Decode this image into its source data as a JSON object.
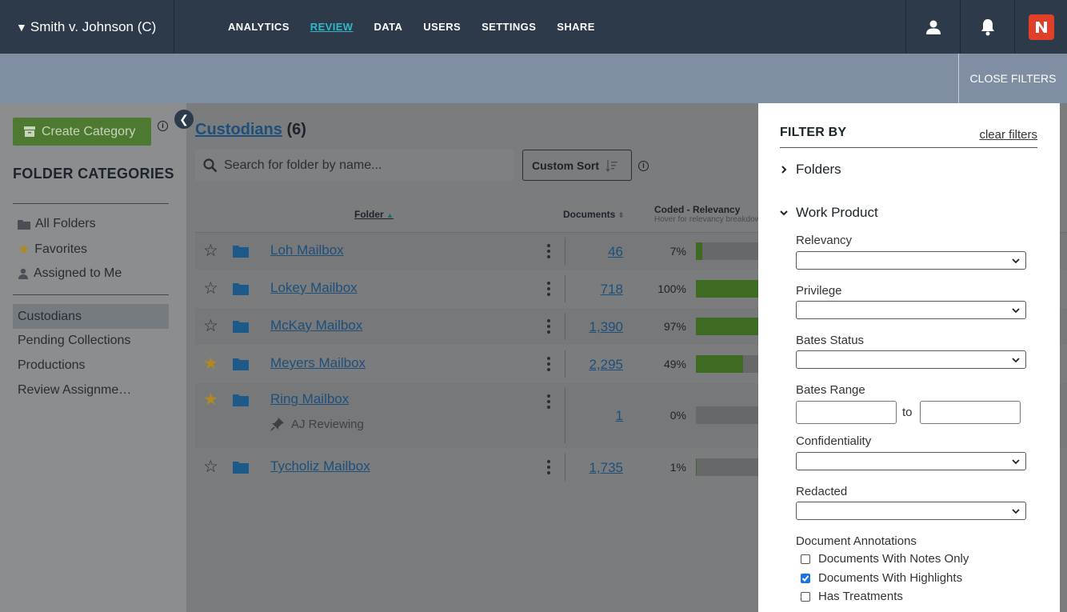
{
  "app": {
    "case_title": "Smith v. Johnson (C)",
    "case_toggle_glyph": "▼"
  },
  "nav": {
    "links": [
      "ANALYTICS",
      "REVIEW",
      "DATA",
      "USERS",
      "SETTINGS",
      "SHARE"
    ],
    "active": "REVIEW"
  },
  "filterbar": {
    "close_label": "CLOSE FILTERS"
  },
  "sidebar": {
    "create_label": "Create Category",
    "section_title": "FOLDER CATEGORIES",
    "quick_items": [
      "All Folders",
      "Favorites",
      "Assigned to Me"
    ],
    "categories": [
      "Custodians",
      "Pending Collections",
      "Productions",
      "Review Assignme…"
    ],
    "selected": "Custodians"
  },
  "content": {
    "title": "Custodians",
    "count": "(6)",
    "search_placeholder": "Search for folder by name...",
    "sort_label": "Custom Sort",
    "columns": {
      "folder": "Folder",
      "documents": "Documents",
      "coded": "Coded - Relevancy",
      "coded_sub": "Hover for relevancy breakdow"
    },
    "rows": [
      {
        "name": "Loh Mailbox",
        "favorite": false,
        "documents": "46",
        "pct_label": "7%",
        "pct": 0.07
      },
      {
        "name": "Lokey Mailbox",
        "favorite": false,
        "documents": "718",
        "pct_label": "100%",
        "pct": 1.0
      },
      {
        "name": "McKay Mailbox",
        "favorite": false,
        "documents": "1,390",
        "pct_label": "97%",
        "pct": 0.97
      },
      {
        "name": "Meyers Mailbox",
        "favorite": true,
        "documents": "2,295",
        "pct_label": "49%",
        "pct": 0.49
      },
      {
        "name": "Ring Mailbox",
        "favorite": true,
        "documents": "1",
        "pct_label": "0%",
        "pct": 0.0,
        "assignee": "AJ Reviewing"
      },
      {
        "name": "Tycholiz Mailbox",
        "favorite": false,
        "documents": "1,735",
        "pct_label": "1%",
        "pct": 0.01
      }
    ]
  },
  "filters": {
    "title": "FILTER BY",
    "clear_label": "clear filters",
    "folders_label": "Folders",
    "work_product_label": "Work Product",
    "relevancy_label": "Relevancy",
    "privilege_label": "Privilege",
    "bates_status_label": "Bates Status",
    "bates_range_label": "Bates Range",
    "bates_to": "to",
    "confidentiality_label": "Confidentiality",
    "redacted_label": "Redacted",
    "annotations_label": "Document Annotations",
    "annotations": [
      {
        "label": "Documents With Notes Only",
        "checked": false
      },
      {
        "label": "Documents With Highlights",
        "checked": true
      },
      {
        "label": "Has Treatments",
        "checked": false
      }
    ]
  },
  "colors": {
    "nav_bg": "#2d3a4a",
    "active_link": "#2eb8c8",
    "brand": "#e0402a",
    "green": "#4d7a30",
    "favorite": "#b08a20"
  }
}
